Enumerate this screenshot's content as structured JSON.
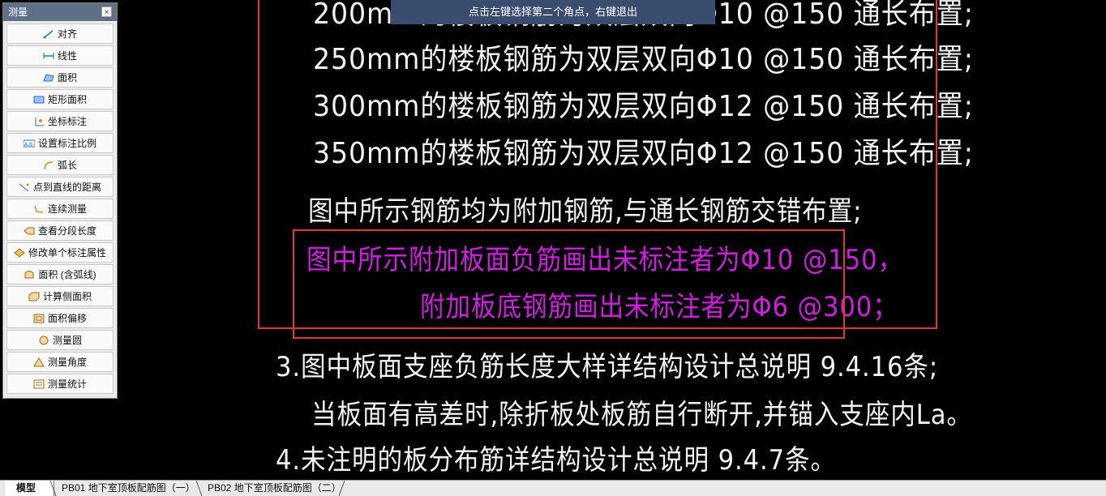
{
  "tooltip": "点击左键选择第二个角点，右键退出",
  "panel": {
    "title": "测量",
    "close": "×",
    "tools": [
      {
        "label": "对齐",
        "icon": "align-icon"
      },
      {
        "label": "线性",
        "icon": "linear-icon"
      },
      {
        "label": "面积",
        "icon": "area-icon"
      },
      {
        "label": "矩形面积",
        "icon": "rect-area-icon"
      },
      {
        "label": "坐标标注",
        "icon": "coordinate-icon"
      },
      {
        "label": "设置标注比例",
        "icon": "scale-icon"
      },
      {
        "label": "弧长",
        "icon": "arc-length-icon"
      },
      {
        "label": "点到直线的距离",
        "icon": "point-line-icon"
      },
      {
        "label": "连续测量",
        "icon": "continuous-measure-icon"
      },
      {
        "label": "查看分段长度",
        "icon": "segment-length-icon"
      },
      {
        "label": "修改单个标注属性",
        "icon": "edit-dim-icon"
      },
      {
        "label": "面积 (含弧线)",
        "icon": "arc-area-icon"
      },
      {
        "label": "计算侧面积",
        "icon": "side-area-icon"
      },
      {
        "label": "面积偏移",
        "icon": "area-offset-icon"
      },
      {
        "label": "测量圆",
        "icon": "circle-icon"
      },
      {
        "label": "测量角度",
        "icon": "angle-icon"
      },
      {
        "label": "测量统计",
        "icon": "statistics-icon"
      }
    ]
  },
  "canvas": {
    "line_200": "200mm的楼板钢筋为双层双向Φ10 @150 通长布置;",
    "line_250": "250mm的楼板钢筋为双层双向Φ10 @150 通长布置;",
    "line_300": "300mm的楼板钢筋为双层双向Φ12 @150 通长布置;",
    "line_350": "350mm的楼板钢筋为双层双向Φ12 @150 通长布置;",
    "line_extra": "图中所示钢筋均为附加钢筋,与通长钢筋交错布置;",
    "line_top_bar": "图中所示附加板面负筋画出未标注者为Φ10 @150，",
    "line_bottom_bar": "附加板底钢筋画出未标注者为Φ6 @300；",
    "note_3": "3.图中板面支座负筋长度大样详结构设计总说明 9.4.16条;",
    "note_3b": "当板面有高差时,除折板处板筋自行断开,并锚入支座内La。",
    "note_4": "4.未注明的板分布筋详结构设计总说明 9.4.7条。"
  },
  "tabs": {
    "model": "模型",
    "pb01": "PB01 地下室顶板配筋图（一）",
    "pb02": "PB02 地下室顶板配筋图（二）"
  },
  "colors": {
    "background": "#000000",
    "text": "#f2f2f2",
    "highlight": "#d01ee0",
    "box": "#e23a2a",
    "tooltip_bg": "#3a4d6e"
  }
}
